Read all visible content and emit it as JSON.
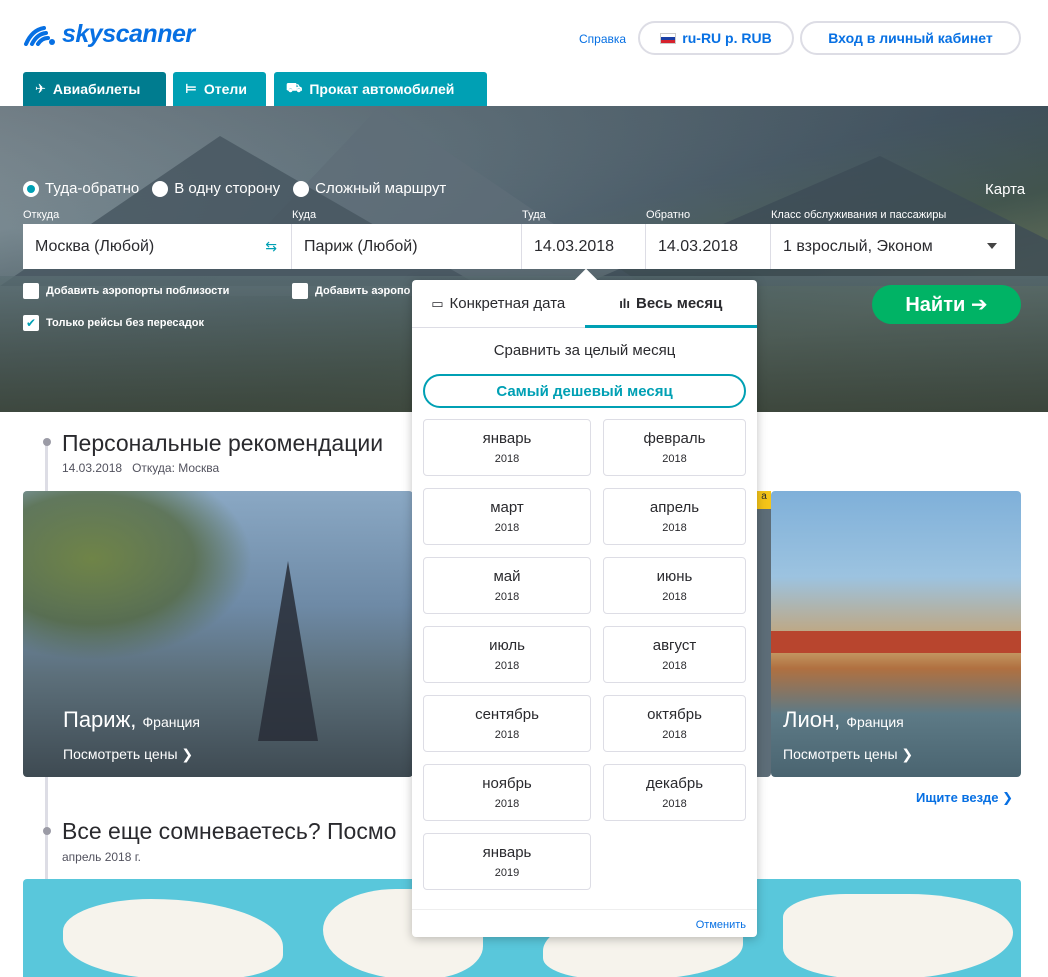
{
  "header": {
    "brand": "skyscanner",
    "help": "Справка",
    "locale": "ru-RU р. RUB",
    "login": "Вход в личный кабинет"
  },
  "tabs": [
    {
      "label": "Авиабилеты",
      "icon": "plane-icon"
    },
    {
      "label": "Отели",
      "icon": "bed-icon"
    },
    {
      "label": "Прокат автомобилей",
      "icon": "car-icon"
    }
  ],
  "search": {
    "trip_types": [
      "Туда-обратно",
      "В одну сторону",
      "Сложный маршрут"
    ],
    "map_link": "Карта",
    "labels": {
      "from": "Откуда",
      "to": "Куда",
      "depart": "Туда",
      "return": "Обратно",
      "class": "Класс обслуживания и пассажиры"
    },
    "values": {
      "from": "Москва (Любой)",
      "to": "Париж (Любой)",
      "depart": "14.03.2018",
      "return": "14.03.2018",
      "class": "1 взрослый, Эконом"
    },
    "nearby_from": "Добавить аэропорты поблизости",
    "nearby_to": "Добавить аэропо",
    "direct_only": "Только рейсы без пересадок",
    "submit": "Найти ➔"
  },
  "recommendations": {
    "title": "Персональные рекомендации",
    "date": "14.03.2018",
    "origin": "Откуда: Москва",
    "cards": [
      {
        "city": "Париж,",
        "country": "Франция",
        "link": "Посмотреть цены ❯"
      },
      {
        "city": "Лион,",
        "country": "Франция",
        "link": "Посмотреть цены ❯"
      }
    ],
    "badge": "а",
    "search_everywhere": "Ищите везде ❯"
  },
  "doubt_section": {
    "title": "Все еще сомневаетесь? Посмо",
    "subtitle": "апрель 2018 г."
  },
  "date_panel": {
    "tab_specific": "Конкретная дата",
    "tab_month": "Весь месяц",
    "compare": "Сравнить за целый месяц",
    "cheapest": "Самый дешевый месяц",
    "months": [
      {
        "name": "январь",
        "year": "2018"
      },
      {
        "name": "февраль",
        "year": "2018"
      },
      {
        "name": "март",
        "year": "2018"
      },
      {
        "name": "апрель",
        "year": "2018"
      },
      {
        "name": "май",
        "year": "2018"
      },
      {
        "name": "июнь",
        "year": "2018"
      },
      {
        "name": "июль",
        "year": "2018"
      },
      {
        "name": "август",
        "year": "2018"
      },
      {
        "name": "сентябрь",
        "year": "2018"
      },
      {
        "name": "октябрь",
        "year": "2018"
      },
      {
        "name": "ноябрь",
        "year": "2018"
      },
      {
        "name": "декабрь",
        "year": "2018"
      },
      {
        "name": "январь",
        "year": "2019"
      }
    ],
    "cancel": "Отменить"
  },
  "colors": {
    "brand_blue": "#0770e3",
    "teal": "#00a0b4",
    "green": "#00b365"
  }
}
